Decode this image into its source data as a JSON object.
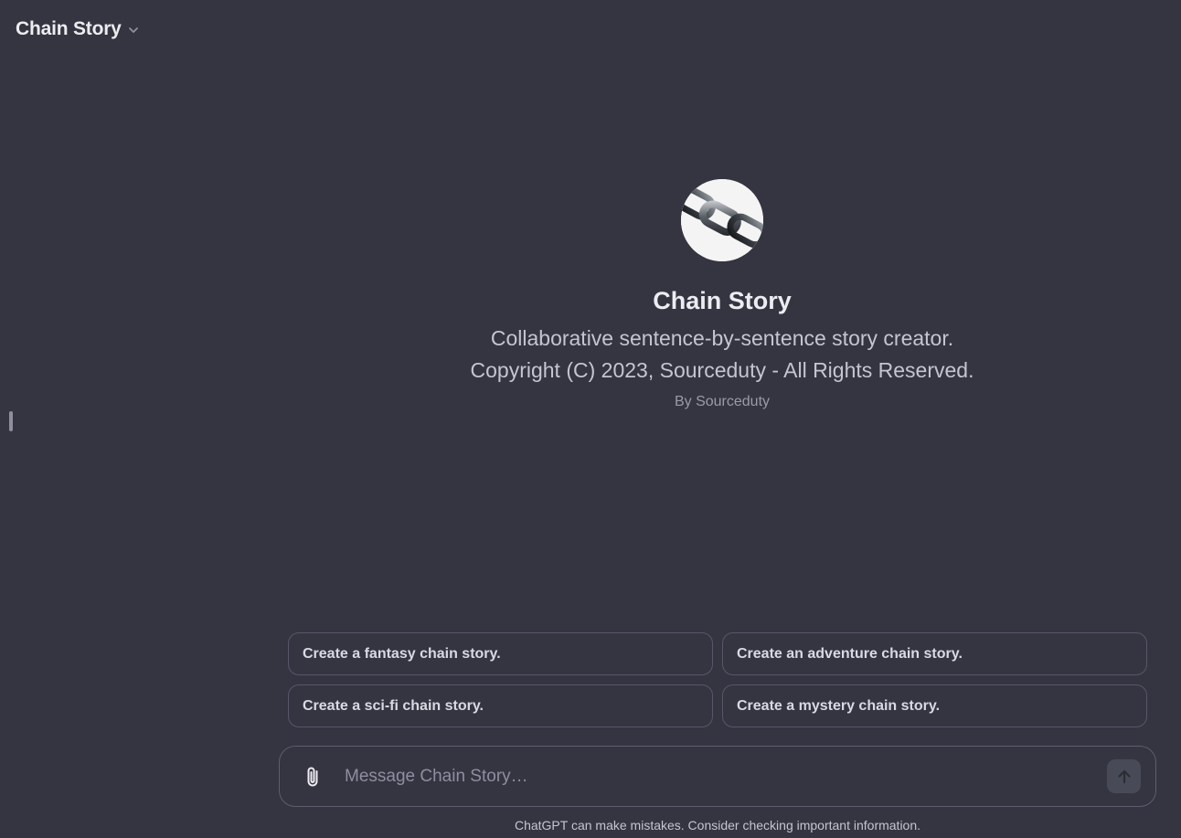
{
  "header": {
    "model_name": "Chain Story",
    "dropdown_icon": "chevron-down-icon"
  },
  "gpt": {
    "avatar_icon": "chain-links-image",
    "name": "Chain Story",
    "description": "Collaborative sentence-by-sentence story creator. Copyright (C) 2023, Sourceduty - All Rights Reserved.",
    "author": "By Sourceduty"
  },
  "suggestions": [
    "Create a fantasy chain story.",
    "Create an adventure chain story.",
    "Create a sci-fi chain story.",
    "Create a mystery chain story."
  ],
  "composer": {
    "placeholder": "Message Chain Story…",
    "value": "",
    "attach_icon": "paperclip-icon",
    "send_icon": "arrow-up-icon"
  },
  "footer": {
    "disclaimer": "ChatGPT can make mistakes. Consider checking important information."
  },
  "colors": {
    "background": "#343541",
    "border": "#565869",
    "text": "#ececf1",
    "muted": "#8e8ea0"
  }
}
